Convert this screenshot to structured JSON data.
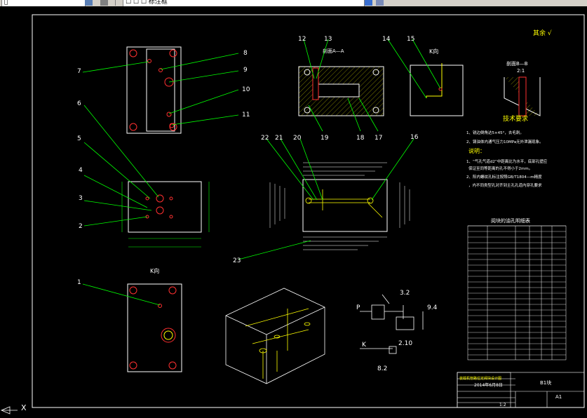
{
  "toolbar": {
    "layer_field": "层̅",
    "style_field": "☐ ☐ ☐ 标注框"
  },
  "drawing": {
    "roughness_note": "其余 √",
    "section_aa": "剖面A—A",
    "view_k": "K向",
    "view_k2": "K向",
    "detail_label": "剖面B—B",
    "detail_scale": "2:1",
    "tech_title": "技术要求",
    "tech_items": [
      "1、锐边倒角达5×45°，去毛刺。",
      "2、铸油体内通气压力10MPa无外泄漏现象。"
    ],
    "note_title": "说明：",
    "note_items": [
      "1、“气孔气道d2”中距离比为水平，底部孔壁应",
      "保证至同等距离的孔不得小于2mm。",
      "2、阳内螺纹孔标注按照GB/T1804—m精度",
      "，内不同类型孔对齐到主孔孔道内穿孔要求"
    ],
    "table_title": "阅块的油孔明细表",
    "callouts": [
      "1",
      "2",
      "3",
      "4",
      "5",
      "6",
      "7",
      "8",
      "9",
      "10",
      "11",
      "12",
      "13",
      "14",
      "15",
      "16",
      "17",
      "18",
      "19",
      "20",
      "21",
      "22",
      "23"
    ],
    "hydraulic_labels": [
      "P",
      "K",
      "3.2",
      "9.4",
      "2.10",
      "8.2"
    ],
    "title_block": {
      "drawing_name": "装载机管路位定阀块设计图",
      "date": "2014年6月8日",
      "sheet": "B1块",
      "size": "A1",
      "scale": "1:2"
    }
  },
  "bottom": {
    "tab_x": "X"
  }
}
